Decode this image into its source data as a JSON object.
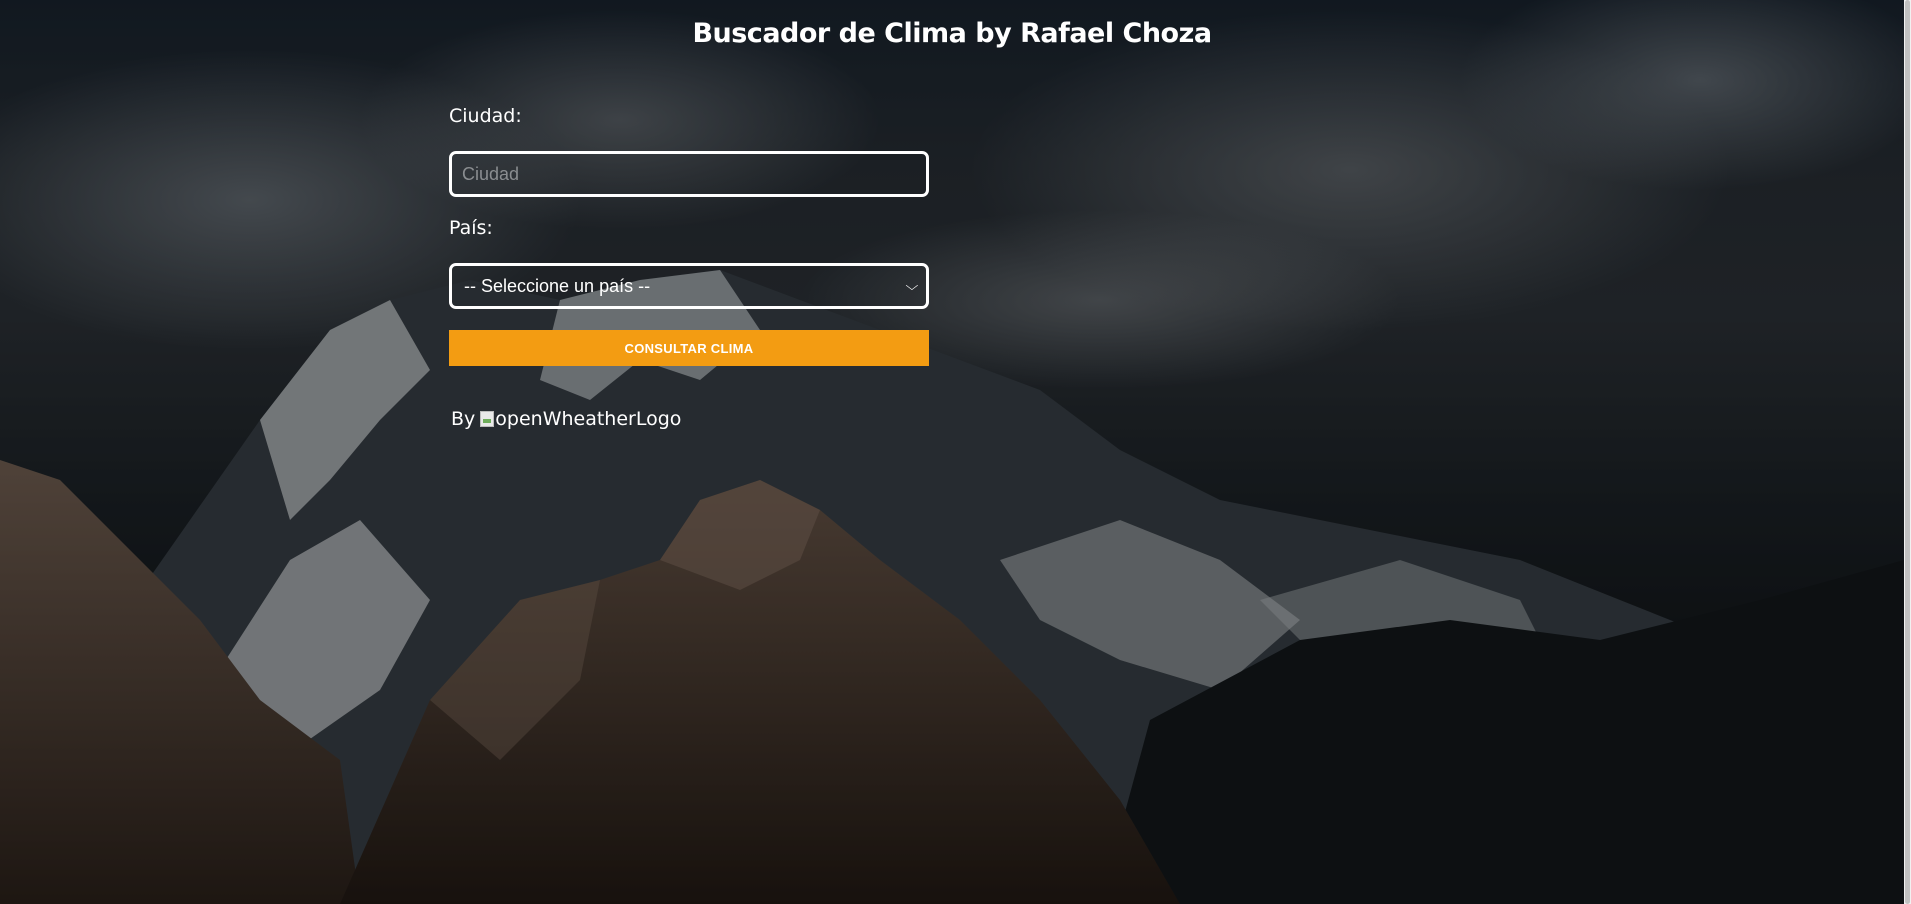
{
  "page": {
    "title": "Buscador de Clima by Rafael Choza"
  },
  "form": {
    "city_label": "Ciudad:",
    "city_placeholder": "Ciudad",
    "city_value": "",
    "country_label": "País:",
    "country_selected": "-- Seleccione un país --",
    "submit_label": "CONSULTAR CLIMA"
  },
  "footer": {
    "by_label": "By",
    "logo_alt": "openWheatherLogo"
  },
  "colors": {
    "accent": "#f39c12",
    "text": "#ffffff",
    "placeholder": "#8a8d90"
  },
  "icons": {
    "select_arrow": "chevron-down-icon",
    "broken_image": "broken-image-icon"
  }
}
